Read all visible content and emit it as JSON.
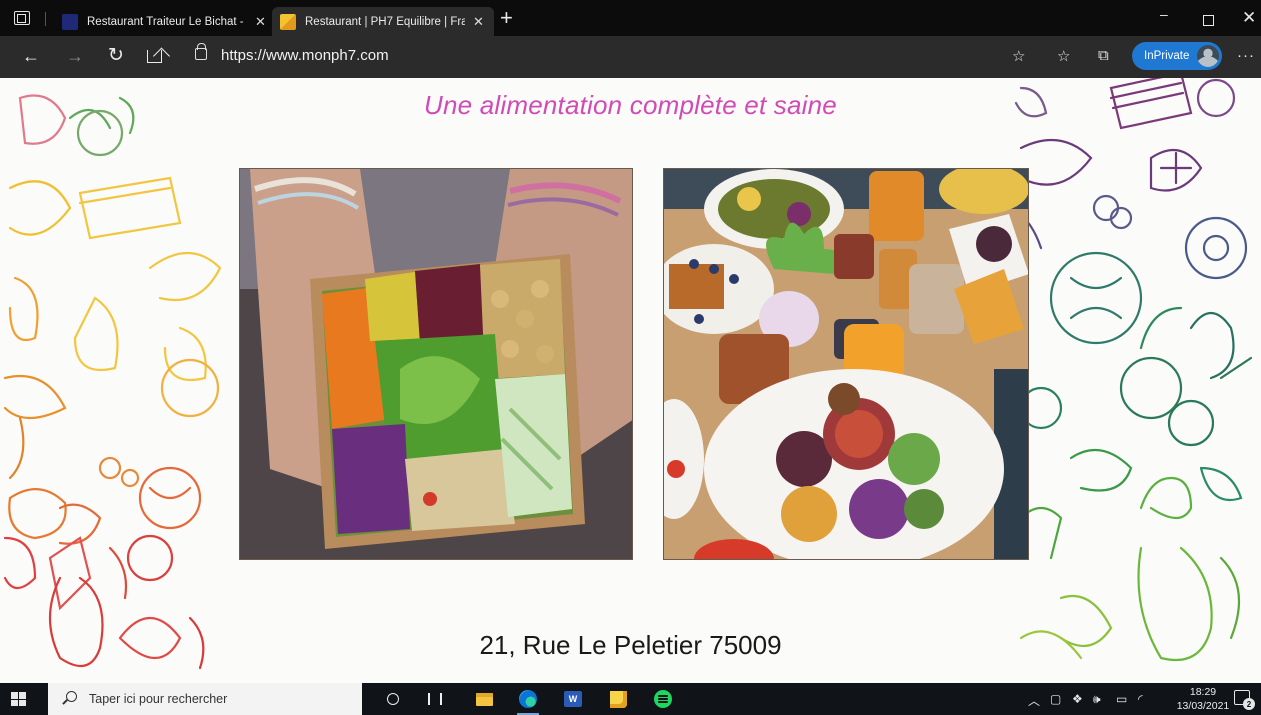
{
  "browser": {
    "tabs": [
      {
        "title": "Restaurant Traiteur Le Bichat - M",
        "active": false
      },
      {
        "title": "Restaurant | PH7 Equilibre | Franc",
        "active": true
      }
    ],
    "url": "https://www.monph7.com",
    "inprivate_label": "InPrivate"
  },
  "page": {
    "headline": "Une alimentation complète et saine",
    "address": "21, Rue Le Peletier 75009",
    "headline_color": "#d04bb4"
  },
  "taskbar": {
    "search_placeholder": "Taper ici pour rechercher",
    "time": "18:29",
    "date": "13/03/2021",
    "notification_count": "2"
  }
}
